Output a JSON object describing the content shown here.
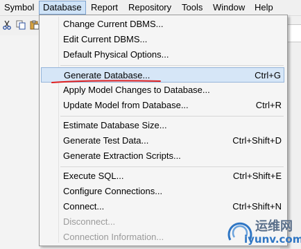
{
  "menubar": {
    "items": [
      "Symbol",
      "Database",
      "Report",
      "Repository",
      "Tools",
      "Window",
      "Help"
    ],
    "active": "Database"
  },
  "toolbar": {
    "icons": [
      "cut-icon",
      "copy-icon",
      "paste-icon"
    ]
  },
  "menu": {
    "items": [
      {
        "label": "Change Current DBMS...",
        "shortcut": ""
      },
      {
        "label": "Edit Current DBMS...",
        "shortcut": ""
      },
      {
        "label": "Default Physical Options...",
        "shortcut": ""
      },
      {
        "label": "Generate Database...",
        "shortcut": "Ctrl+G"
      },
      {
        "label": "Apply Model Changes to Database...",
        "shortcut": ""
      },
      {
        "label": "Update Model from Database...",
        "shortcut": "Ctrl+R"
      },
      {
        "label": "Estimate Database Size...",
        "shortcut": ""
      },
      {
        "label": "Generate Test Data...",
        "shortcut": "Ctrl+Shift+D"
      },
      {
        "label": "Generate Extraction Scripts...",
        "shortcut": ""
      },
      {
        "label": "Execute SQL...",
        "shortcut": "Ctrl+Shift+E"
      },
      {
        "label": "Configure Connections...",
        "shortcut": ""
      },
      {
        "label": "Connect...",
        "shortcut": "Ctrl+Shift+N"
      },
      {
        "label": "Disconnect...",
        "shortcut": ""
      },
      {
        "label": "Connection Information...",
        "shortcut": ""
      }
    ],
    "highlighted": "Generate Database...",
    "disabled": [
      "Disconnect...",
      "Connection Information..."
    ]
  },
  "watermark": {
    "cn": "运维网",
    "url": "iyunv.com"
  },
  "colors": {
    "highlight_bg": "#d6e6f7",
    "annotation_red": "#e02020",
    "menu_bg": "#f5f5f5"
  }
}
